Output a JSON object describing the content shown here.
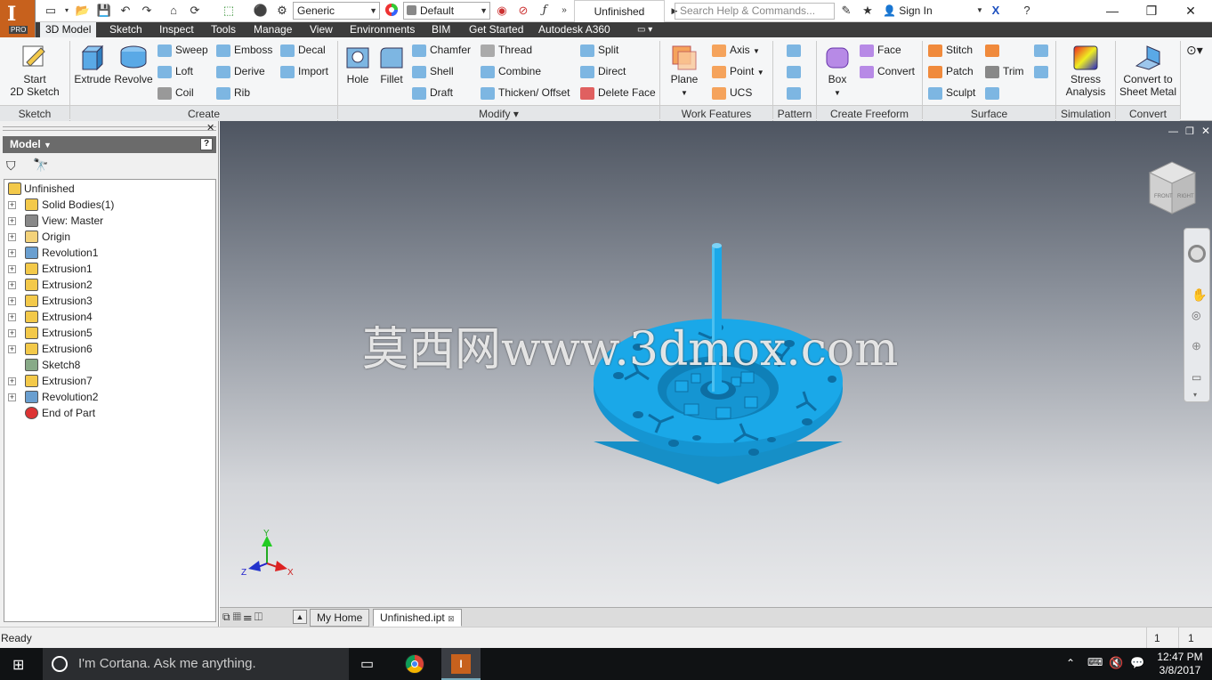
{
  "titlebar": {
    "app_badge": "PRO",
    "material": "Generic",
    "appearance": "Default",
    "document_title": "Unfinished",
    "search_placeholder": "Search Help & Commands...",
    "sign_in": "Sign In"
  },
  "tabs": [
    "3D Model",
    "Sketch",
    "Inspect",
    "Tools",
    "Manage",
    "View",
    "Environments",
    "BIM",
    "Get Started",
    "Autodesk A360"
  ],
  "ribbon": {
    "sketch": {
      "start_sketch_line1": "Start",
      "start_sketch_line2": "2D Sketch",
      "title": "Sketch"
    },
    "create": {
      "extrude": "Extrude",
      "revolve": "Revolve",
      "sweep": "Sweep",
      "loft": "Loft",
      "coil": "Coil",
      "emboss": "Emboss",
      "derive": "Derive",
      "rib": "Rib",
      "decal": "Decal",
      "import": "Import",
      "title": "Create"
    },
    "modify": {
      "hole": "Hole",
      "fillet": "Fillet",
      "chamfer": "Chamfer",
      "shell": "Shell",
      "draft": "Draft",
      "thread": "Thread",
      "combine": "Combine",
      "thicken": "Thicken/ Offset",
      "split": "Split",
      "direct": "Direct",
      "delete_face": "Delete Face",
      "title": "Modify"
    },
    "work_features": {
      "plane": "Plane",
      "axis": "Axis",
      "point": "Point",
      "ucs": "UCS",
      "title": "Work Features"
    },
    "pattern": {
      "title": "Pattern"
    },
    "freeform": {
      "box": "Box",
      "face": "Face",
      "convert": "Convert",
      "title": "Create Freeform"
    },
    "surface": {
      "stitch": "Stitch",
      "patch": "Patch",
      "sculpt": "Sculpt",
      "trim": "Trim",
      "title": "Surface"
    },
    "simulation": {
      "stress_line1": "Stress",
      "stress_line2": "Analysis",
      "title": "Simulation"
    },
    "convert": {
      "sheet_line1": "Convert to",
      "sheet_line2": "Sheet Metal",
      "title": "Convert"
    }
  },
  "browser": {
    "header": "Model",
    "tree": [
      {
        "label": "Unfinished",
        "icon": "part-icon",
        "expand": false,
        "root": true
      },
      {
        "label": "Solid Bodies(1)",
        "icon": "solid-bodies-icon",
        "expand": true
      },
      {
        "label": "View: Master",
        "icon": "view-icon",
        "expand": true
      },
      {
        "label": "Origin",
        "icon": "folder-icon",
        "expand": true
      },
      {
        "label": "Revolution1",
        "icon": "revolution-icon",
        "expand": true
      },
      {
        "label": "Extrusion1",
        "icon": "extrusion-icon",
        "expand": true
      },
      {
        "label": "Extrusion2",
        "icon": "extrusion-icon",
        "expand": true
      },
      {
        "label": "Extrusion3",
        "icon": "extrusion-icon",
        "expand": true
      },
      {
        "label": "Extrusion4",
        "icon": "extrusion-icon",
        "expand": true
      },
      {
        "label": "Extrusion5",
        "icon": "extrusion-icon",
        "expand": true
      },
      {
        "label": "Extrusion6",
        "icon": "extrusion-icon",
        "expand": true
      },
      {
        "label": "Sketch8",
        "icon": "sketch-icon",
        "expand": false
      },
      {
        "label": "Extrusion7",
        "icon": "extrusion-icon",
        "expand": true
      },
      {
        "label": "Revolution2",
        "icon": "revolution-icon",
        "expand": true
      },
      {
        "label": "End of Part",
        "icon": "end-of-part-icon",
        "expand": false
      }
    ]
  },
  "viewport": {
    "watermark": "莫西网www.3dmox.com",
    "viewcube_front": "FRONT",
    "viewcube_right": "RIGHT",
    "triad": {
      "x": "X",
      "y": "Y",
      "z": "Z"
    },
    "model_color": "#1aa8e8"
  },
  "doc_tabs": {
    "home": "My Home",
    "file": "Unfinished.ipt"
  },
  "status": {
    "text": "Ready",
    "count1": "1",
    "count2": "1"
  },
  "taskbar": {
    "cortana": "I'm Cortana. Ask me anything.",
    "time": "12:47 PM",
    "date": "3/8/2017"
  }
}
